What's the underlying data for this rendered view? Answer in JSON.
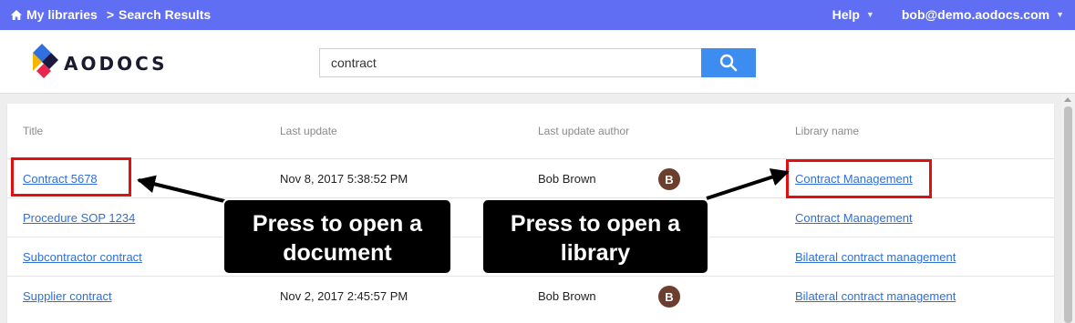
{
  "topbar": {
    "breadcrumbs": [
      "My libraries",
      "Search Results"
    ],
    "separator": ">",
    "help_label": "Help",
    "user_email": "bob@demo.aodocs.com",
    "bg_color": "#5f6ef2"
  },
  "header": {
    "logo_text": "AODOCS",
    "search_value": "contract",
    "search_button_icon": "search-icon",
    "search_button_color": "#3d8cf0"
  },
  "results": {
    "columns": [
      "Title",
      "Last update",
      "Last update author",
      "Library name"
    ],
    "rows": [
      {
        "title": "Contract 5678",
        "last_update": "Nov 8, 2017 5:38:52 PM",
        "author": "Bob Brown",
        "avatar_initial": "B",
        "library": "Contract Management"
      },
      {
        "title": "Procedure SOP 1234",
        "last_update": "",
        "author": "",
        "avatar_initial": "",
        "library": "Contract Management"
      },
      {
        "title": "Subcontractor contract",
        "last_update": "",
        "author": "",
        "avatar_initial": "",
        "library": "Bilateral contract management"
      },
      {
        "title": "Supplier contract",
        "last_update": "Nov 2, 2017 2:45:57 PM",
        "author": "Bob Brown",
        "avatar_initial": "B",
        "library": "Bilateral contract management"
      }
    ]
  },
  "annotations": {
    "open_document_line1": "Press to open a",
    "open_document_line2": "document",
    "open_library_line1": "Press to open a",
    "open_library_line2": "library",
    "highlight_color": "#e01010"
  }
}
